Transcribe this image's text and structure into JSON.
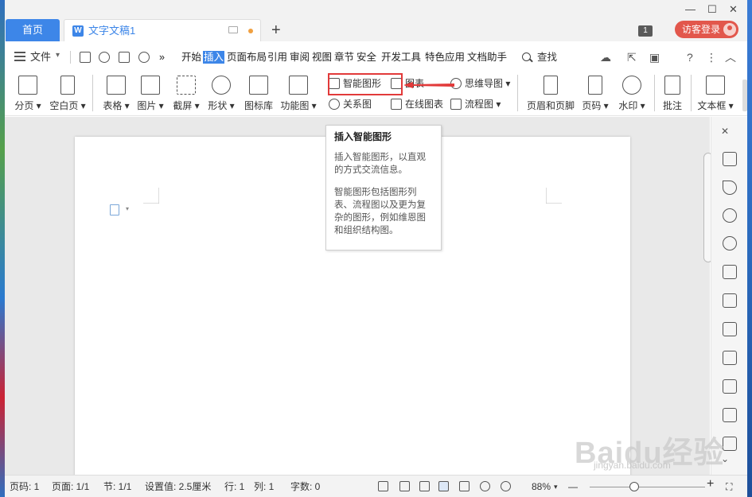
{
  "titlebar": {
    "home_tab": "首页",
    "doc_tab": "文字文稿1",
    "new_tab": "+",
    "badge": "1",
    "login": "访客登录",
    "minimize": "—",
    "maximize": "☐",
    "close": "✕"
  },
  "menubar": {
    "file": "文件",
    "more": "»",
    "tabs": [
      "开始",
      "插入",
      "页面布局",
      "引用",
      "审阅",
      "视图",
      "章节",
      "安全",
      "开发工具",
      "特色应用",
      "文档助手"
    ],
    "active_tab": "插入",
    "search": "查找",
    "help": "?",
    "more_dots": "⋮",
    "collapse": "︿"
  },
  "ribbon": {
    "page_break": "分页",
    "blank_page": "空白页",
    "table": "表格",
    "picture": "图片",
    "screenshot": "截屏",
    "shape": "形状",
    "icon_lib": "图标库",
    "func_chart": "功能图",
    "smart_art": "智能图形",
    "chart": "图表",
    "relation": "关系图",
    "online_chart": "在线图表",
    "mind_map": "思维导图",
    "flowchart": "流程图",
    "header_footer": "页眉和页脚",
    "page_number": "页码",
    "watermark": "水印",
    "comment": "批注",
    "text_box": "文本框"
  },
  "tooltip": {
    "title": "插入智能图形",
    "line1": "插入智能图形，以直观",
    "line2": "的方式交流信息。",
    "line3": "智能图形包括图形列",
    "line4": "表、流程图以及更为复",
    "line5": "杂的图形，例如维恩图",
    "line6": "和组织结构图。"
  },
  "statusbar": {
    "page_num": "页码: 1",
    "pages": "页面: 1/1",
    "section": "节: 1/1",
    "setting": "设置值: 2.5厘米",
    "row": "行: 1",
    "col": "列: 1",
    "words": "字数: 0",
    "zoom": "88%",
    "zoom_minus": "—",
    "zoom_plus": "+"
  },
  "watermark": {
    "logo": "Baidu经验",
    "url": "jingyan.baidu.com"
  },
  "colors": {
    "accent": "#3d86e8",
    "highlight": "#e23a3a",
    "login": "#e2574c"
  }
}
